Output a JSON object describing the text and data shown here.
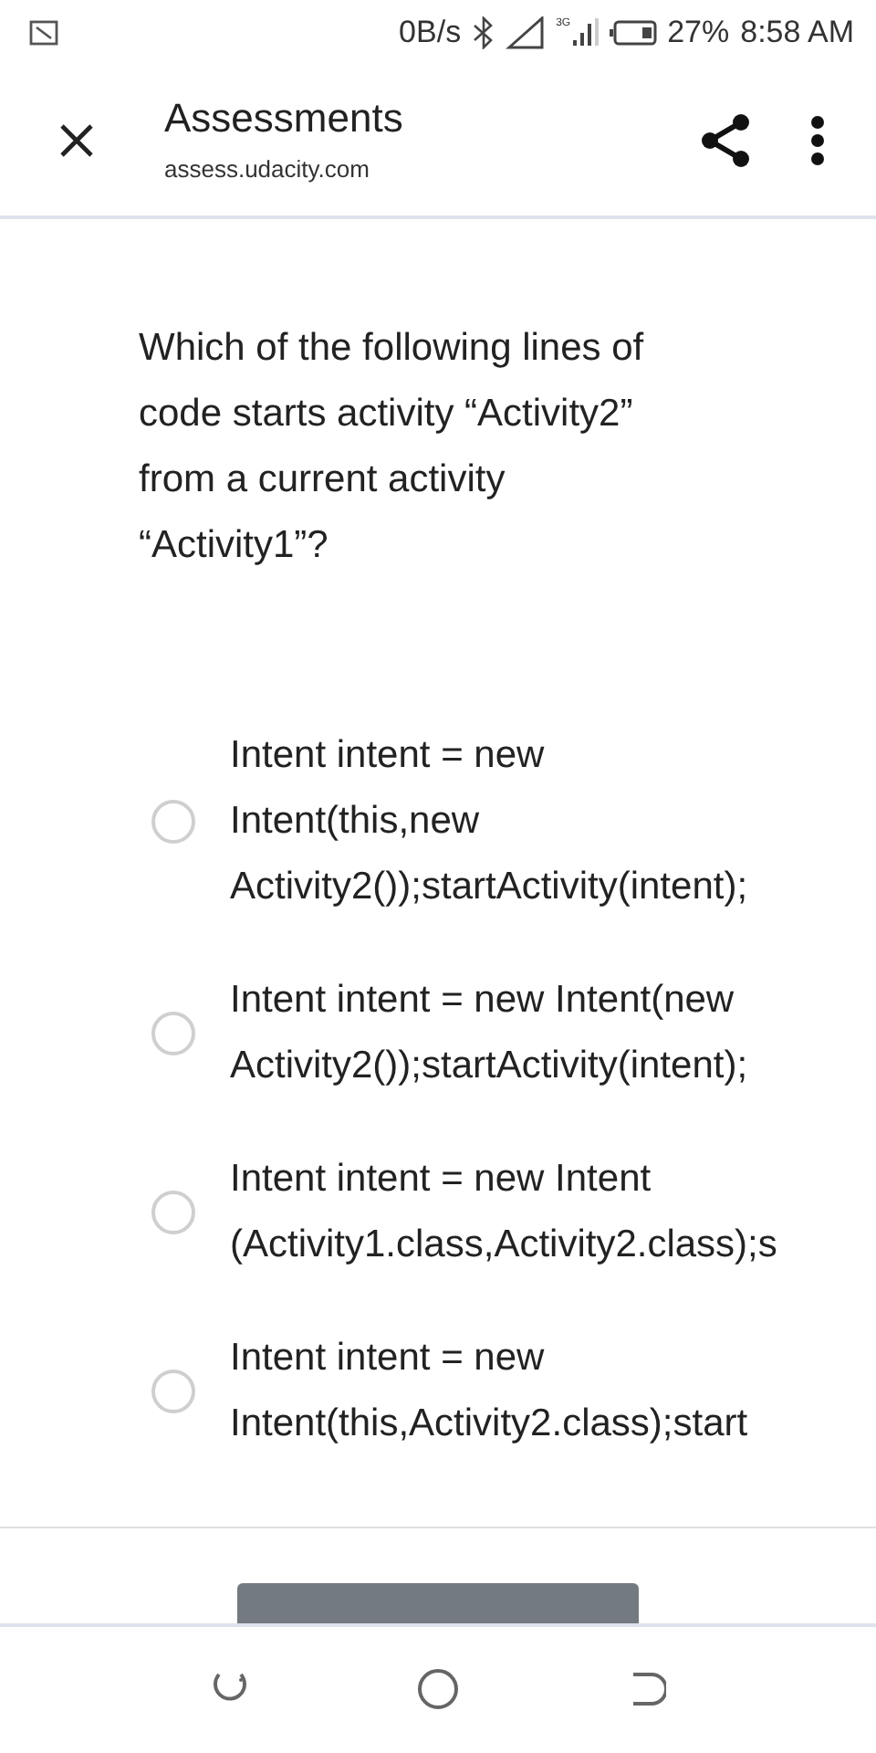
{
  "status_bar": {
    "speed": "0B/s",
    "network": "3G",
    "battery": "27%",
    "time": "8:58 AM"
  },
  "header": {
    "title": "Assessments",
    "url": "assess.udacity.com"
  },
  "question": {
    "lines": [
      "Which of the following lines of",
      "code starts activity “Activity2”",
      "from a current activity",
      "“Activity1”?"
    ]
  },
  "options": [
    {
      "lines": [
        "Intent intent = new",
        "Intent(this,new",
        "Activity2());startActivity(intent);"
      ],
      "selected": false
    },
    {
      "lines": [
        "Intent intent = new Intent(new",
        "Activity2());startActivity(intent);"
      ],
      "selected": false
    },
    {
      "lines": [
        "Intent intent = new Intent",
        "(Activity1.class,Activity2.class);s"
      ],
      "selected": false
    },
    {
      "lines": [
        "Intent intent = new",
        "Intent(this,Activity2.class);start"
      ],
      "selected": false
    }
  ]
}
